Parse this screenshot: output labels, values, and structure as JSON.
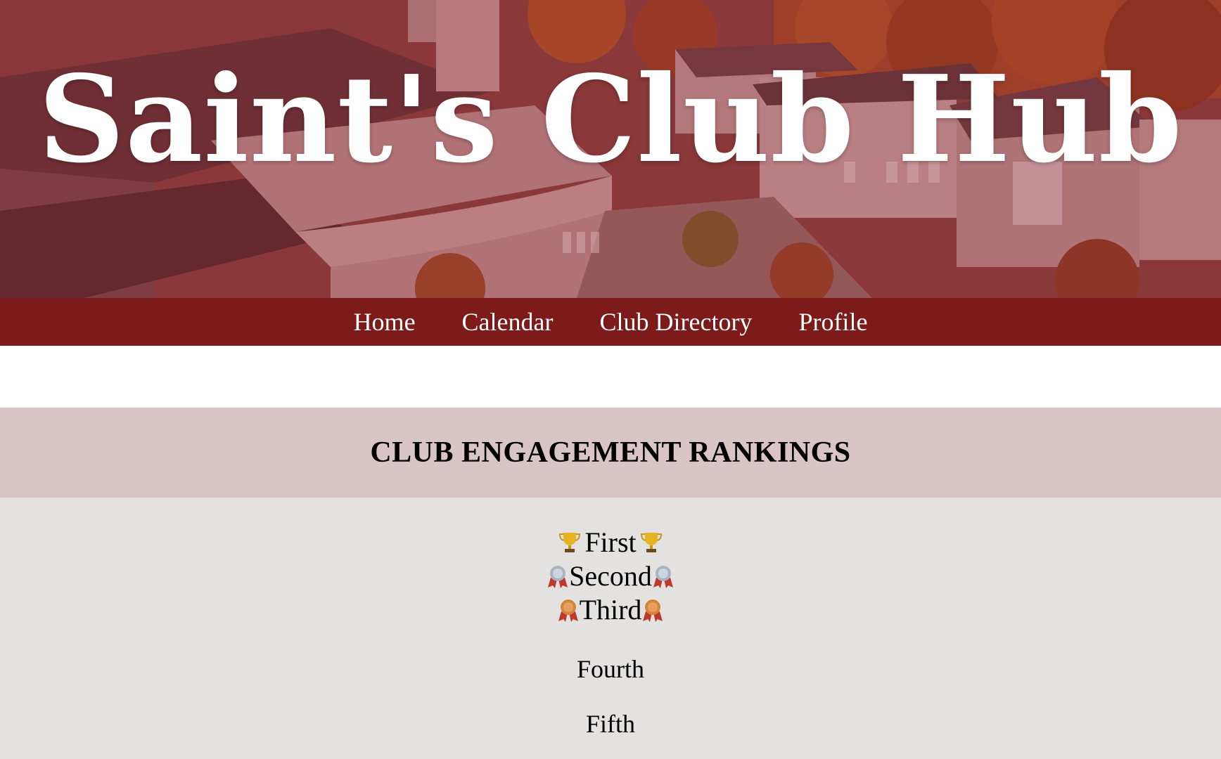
{
  "hero": {
    "title": "Saint's Club Hub"
  },
  "nav": {
    "items": [
      {
        "label": "Home"
      },
      {
        "label": "Calendar"
      },
      {
        "label": "Club Directory"
      },
      {
        "label": "Profile"
      }
    ]
  },
  "rankings": {
    "heading": "CLUB ENGAGEMENT RANKINGS",
    "places": [
      {
        "label": "First",
        "icon": "trophy-icon"
      },
      {
        "label": "Second",
        "icon": "silver-medal-icon"
      },
      {
        "label": "Third",
        "icon": "bronze-medal-icon"
      },
      {
        "label": "Fourth"
      },
      {
        "label": "Fifth"
      }
    ]
  },
  "colors": {
    "nav_bg": "#7d1a1a",
    "header_band": "#d9c4c6",
    "body_band": "#e4e2e1"
  }
}
